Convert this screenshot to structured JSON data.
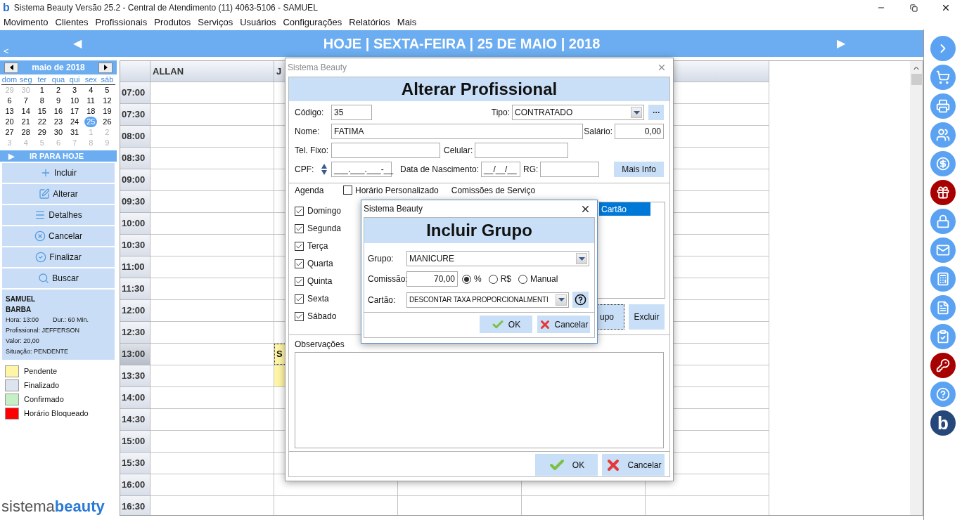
{
  "title_bar": {
    "logo": "b",
    "title": "Sistema Beauty Versão 25.2 - Central de Atendimento (11) 4063-5106 - SAMUEL"
  },
  "menu": [
    "Movimento",
    "Clientes",
    "Profissionais",
    "Produtos",
    "Serviços",
    "Usuários",
    "Configurações",
    "Relatórios",
    "Mais"
  ],
  "header": {
    "back": "<",
    "prev": "◀",
    "title": "HOJE | SEXTA-FEIRA | 25 DE MAIO | 2018",
    "next": "▶"
  },
  "calendar": {
    "month": "maio de 2018",
    "weekdays": [
      "dom",
      "seg",
      "ter",
      "qua",
      "qui",
      "sex",
      "sáb"
    ],
    "weeks": [
      [
        {
          "day": "29",
          "muted": true,
          "selected": false
        },
        {
          "day": "30",
          "muted": true,
          "selected": false
        },
        {
          "day": "1",
          "muted": false,
          "selected": false
        },
        {
          "day": "2",
          "muted": false,
          "selected": false
        },
        {
          "day": "3",
          "muted": false,
          "selected": false
        },
        {
          "day": "4",
          "muted": false,
          "selected": false
        },
        {
          "day": "5",
          "muted": false,
          "selected": false
        }
      ],
      [
        {
          "day": "6",
          "muted": false,
          "selected": false
        },
        {
          "day": "7",
          "muted": false,
          "selected": false
        },
        {
          "day": "8",
          "muted": false,
          "selected": false
        },
        {
          "day": "9",
          "muted": false,
          "selected": false
        },
        {
          "day": "10",
          "muted": false,
          "selected": false
        },
        {
          "day": "11",
          "muted": false,
          "selected": false
        },
        {
          "day": "12",
          "muted": false,
          "selected": false
        }
      ],
      [
        {
          "day": "13",
          "muted": false,
          "selected": false
        },
        {
          "day": "14",
          "muted": false,
          "selected": false
        },
        {
          "day": "15",
          "muted": false,
          "selected": false
        },
        {
          "day": "16",
          "muted": false,
          "selected": false
        },
        {
          "day": "17",
          "muted": false,
          "selected": false
        },
        {
          "day": "18",
          "muted": false,
          "selected": false
        },
        {
          "day": "19",
          "muted": false,
          "selected": false
        }
      ],
      [
        {
          "day": "20",
          "muted": false,
          "selected": false
        },
        {
          "day": "21",
          "muted": false,
          "selected": false
        },
        {
          "day": "22",
          "muted": false,
          "selected": false
        },
        {
          "day": "23",
          "muted": false,
          "selected": false
        },
        {
          "day": "24",
          "muted": false,
          "selected": false
        },
        {
          "day": "25",
          "muted": false,
          "selected": true
        },
        {
          "day": "26",
          "muted": false,
          "selected": false
        }
      ],
      [
        {
          "day": "27",
          "muted": false,
          "selected": false
        },
        {
          "day": "28",
          "muted": false,
          "selected": false
        },
        {
          "day": "29",
          "muted": false,
          "selected": false
        },
        {
          "day": "30",
          "muted": false,
          "selected": false
        },
        {
          "day": "31",
          "muted": false,
          "selected": false
        },
        {
          "day": "1",
          "muted": true,
          "selected": false
        },
        {
          "day": "2",
          "muted": true,
          "selected": false
        }
      ],
      [
        {
          "day": "3",
          "muted": true,
          "selected": false
        },
        {
          "day": "4",
          "muted": true,
          "selected": false
        },
        {
          "day": "5",
          "muted": true,
          "selected": false
        },
        {
          "day": "6",
          "muted": true,
          "selected": false
        },
        {
          "day": "7",
          "muted": true,
          "selected": false
        },
        {
          "day": "8",
          "muted": true,
          "selected": false
        },
        {
          "day": "9",
          "muted": true,
          "selected": false
        }
      ]
    ]
  },
  "go_today": {
    "icon": "▶",
    "label": "IR PARA HOJE"
  },
  "actions": [
    {
      "label": "Incluir",
      "kind": "add"
    },
    {
      "label": "Alterar",
      "kind": "edit"
    },
    {
      "label": "Detalhes",
      "kind": "details"
    },
    {
      "label": "Cancelar",
      "kind": "cancel"
    },
    {
      "label": "Finalizar",
      "kind": "finish"
    },
    {
      "label": "Buscar",
      "kind": "search"
    }
  ],
  "appointment_info": {
    "client": "SAMUEL",
    "service": "BARBA",
    "hour": "Hora: 13:00",
    "duration": "Dur.: 60 Min.",
    "professional": "Profissional: JEFFERSON",
    "value": "Valor: 20,00",
    "status": "Situação: PENDENTE"
  },
  "legend": [
    {
      "label": "Pendente",
      "color": "#fff5a6"
    },
    {
      "label": "Finalizado",
      "color": "#dde3ef"
    },
    {
      "label": "Confirmado",
      "color": "#c5efc5"
    },
    {
      "label": "Horário Bloqueado",
      "color": "#ff0000"
    }
  ],
  "logo": {
    "light": "sistema",
    "bold": "beauty"
  },
  "schedule": {
    "columns": [
      "ALLAN",
      "J"
    ],
    "rows": [
      {
        "time": "07:00",
        "selected": false
      },
      {
        "time": "07:30",
        "selected": false
      },
      {
        "time": "08:00",
        "selected": false
      },
      {
        "time": "08:30",
        "selected": false
      },
      {
        "time": "09:00",
        "selected": false
      },
      {
        "time": "09:30",
        "selected": false
      },
      {
        "time": "10:00",
        "selected": false
      },
      {
        "time": "10:30",
        "selected": false
      },
      {
        "time": "11:00",
        "selected": false
      },
      {
        "time": "11:30",
        "selected": false
      },
      {
        "time": "12:00",
        "selected": false
      },
      {
        "time": "12:30",
        "selected": false
      },
      {
        "time": "13:00",
        "selected": true,
        "slots": [
          {
            "kind": "empty"
          },
          {
            "kind": "pendente",
            "text": "S"
          }
        ]
      },
      {
        "time": "13:30",
        "selected": false,
        "slots": [
          {
            "kind": "empty"
          },
          {
            "kind": "pendente"
          }
        ]
      },
      {
        "time": "14:00",
        "selected": false
      },
      {
        "time": "14:30",
        "selected": false
      },
      {
        "time": "15:00",
        "selected": false
      },
      {
        "time": "15:30",
        "selected": false
      },
      {
        "time": "16:00",
        "selected": false
      },
      {
        "time": "16:30",
        "selected": false
      }
    ]
  },
  "side_icons": [
    {
      "kind": "next",
      "color": "#5ba3f2"
    },
    {
      "kind": "cart",
      "color": "#5ba3f2"
    },
    {
      "kind": "register",
      "color": "#5ba3f2"
    },
    {
      "kind": "users",
      "color": "#5ba3f2"
    },
    {
      "kind": "money",
      "color": "#5ba3f2"
    },
    {
      "kind": "gift",
      "color": "#a80000"
    },
    {
      "kind": "lock",
      "color": "#5ba3f2"
    },
    {
      "kind": "mail",
      "color": "#5ba3f2"
    },
    {
      "kind": "calculator",
      "color": "#5ba3f2"
    },
    {
      "kind": "document",
      "color": "#5ba3f2"
    },
    {
      "kind": "checklist",
      "color": "#5ba3f2"
    },
    {
      "kind": "key",
      "color": "#a80000"
    },
    {
      "kind": "help",
      "color": "#5ba3f2"
    },
    {
      "kind": "logo",
      "color": "#26477a",
      "text": "b"
    }
  ],
  "dialog_profissional": {
    "window_title": "Sistema Beauty",
    "heading": "Alterar Profissional",
    "codigo": {
      "label": "Código:",
      "value": "35"
    },
    "tipo": {
      "label": "Tipo:",
      "value": "CONTRATADO"
    },
    "nome": {
      "label": "Nome:",
      "value": "FATIMA"
    },
    "salario": {
      "label": "Salário:",
      "value": "0,00"
    },
    "tel_fixo": {
      "label": "Tel. Fixo:"
    },
    "celular": {
      "label": "Celular:"
    },
    "cpf": {
      "label": "CPF:",
      "value": "___.___.___-__"
    },
    "nascimento": {
      "label": "Data de Nascimento:",
      "value": "__/__/__"
    },
    "rg": {
      "label": "RG:"
    },
    "mais_info": "Mais Info",
    "agenda_label": "Agenda",
    "horario_personalizado": {
      "label": "Horário Personalizado",
      "checked": false
    },
    "comissoes_label": "Comissões de Serviço",
    "days": [
      {
        "label": "Domingo",
        "checked": true
      },
      {
        "label": "Segunda",
        "checked": true
      },
      {
        "label": "Terça",
        "checked": true
      },
      {
        "label": "Quarta",
        "checked": true
      },
      {
        "label": "Quinta",
        "checked": true
      },
      {
        "label": "Sexta",
        "checked": true
      },
      {
        "label": "Sábado",
        "checked": true
      }
    ],
    "table_columns": [
      {
        "label": "Cartão",
        "selected": true
      }
    ],
    "group_buttons": [
      "upo",
      "Excluir"
    ],
    "observacoes_label": "Observações",
    "ok": "OK",
    "cancel": "Cancelar"
  },
  "dialog_grupo": {
    "window_title": "Sistema Beauty",
    "heading": "Incluir Grupo",
    "grupo": {
      "label": "Grupo:",
      "value": "MANICURE"
    },
    "comissao": {
      "label": "Comissão:",
      "value": "70,00"
    },
    "units": [
      {
        "label": "%",
        "selected": true
      },
      {
        "label": "R$",
        "selected": false
      },
      {
        "label": "Manual",
        "selected": false
      }
    ],
    "cartao": {
      "label": "Cartão:",
      "value": "DESCONTAR TAXA PROPORCIONALMENTI"
    },
    "ok": "OK",
    "cancel": "Cancelar"
  }
}
